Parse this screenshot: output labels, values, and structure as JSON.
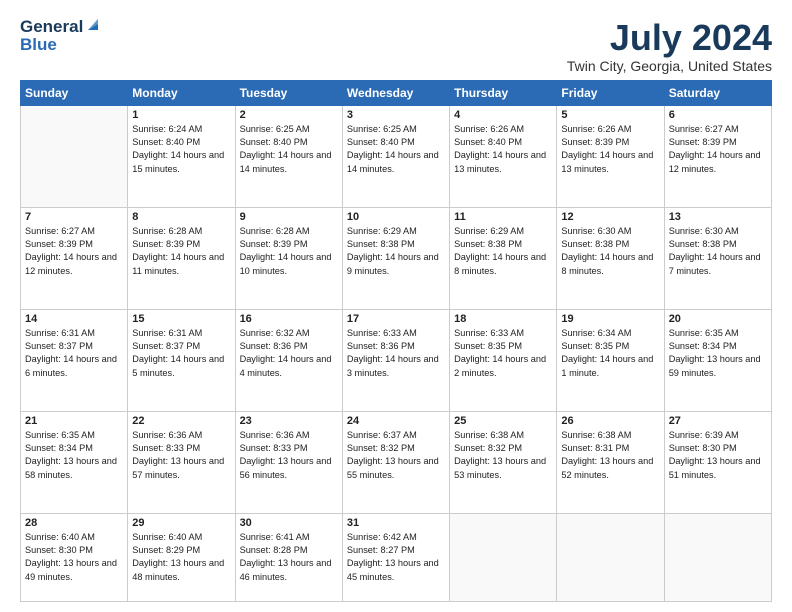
{
  "logo": {
    "general": "General",
    "blue": "Blue"
  },
  "header": {
    "title": "July 2024",
    "subtitle": "Twin City, Georgia, United States"
  },
  "weekdays": [
    "Sunday",
    "Monday",
    "Tuesday",
    "Wednesday",
    "Thursday",
    "Friday",
    "Saturday"
  ],
  "weeks": [
    [
      {
        "day": "",
        "sunrise": "",
        "sunset": "",
        "daylight": ""
      },
      {
        "day": "1",
        "sunrise": "Sunrise: 6:24 AM",
        "sunset": "Sunset: 8:40 PM",
        "daylight": "Daylight: 14 hours and 15 minutes."
      },
      {
        "day": "2",
        "sunrise": "Sunrise: 6:25 AM",
        "sunset": "Sunset: 8:40 PM",
        "daylight": "Daylight: 14 hours and 14 minutes."
      },
      {
        "day": "3",
        "sunrise": "Sunrise: 6:25 AM",
        "sunset": "Sunset: 8:40 PM",
        "daylight": "Daylight: 14 hours and 14 minutes."
      },
      {
        "day": "4",
        "sunrise": "Sunrise: 6:26 AM",
        "sunset": "Sunset: 8:40 PM",
        "daylight": "Daylight: 14 hours and 13 minutes."
      },
      {
        "day": "5",
        "sunrise": "Sunrise: 6:26 AM",
        "sunset": "Sunset: 8:39 PM",
        "daylight": "Daylight: 14 hours and 13 minutes."
      },
      {
        "day": "6",
        "sunrise": "Sunrise: 6:27 AM",
        "sunset": "Sunset: 8:39 PM",
        "daylight": "Daylight: 14 hours and 12 minutes."
      }
    ],
    [
      {
        "day": "7",
        "sunrise": "Sunrise: 6:27 AM",
        "sunset": "Sunset: 8:39 PM",
        "daylight": "Daylight: 14 hours and 12 minutes."
      },
      {
        "day": "8",
        "sunrise": "Sunrise: 6:28 AM",
        "sunset": "Sunset: 8:39 PM",
        "daylight": "Daylight: 14 hours and 11 minutes."
      },
      {
        "day": "9",
        "sunrise": "Sunrise: 6:28 AM",
        "sunset": "Sunset: 8:39 PM",
        "daylight": "Daylight: 14 hours and 10 minutes."
      },
      {
        "day": "10",
        "sunrise": "Sunrise: 6:29 AM",
        "sunset": "Sunset: 8:38 PM",
        "daylight": "Daylight: 14 hours and 9 minutes."
      },
      {
        "day": "11",
        "sunrise": "Sunrise: 6:29 AM",
        "sunset": "Sunset: 8:38 PM",
        "daylight": "Daylight: 14 hours and 8 minutes."
      },
      {
        "day": "12",
        "sunrise": "Sunrise: 6:30 AM",
        "sunset": "Sunset: 8:38 PM",
        "daylight": "Daylight: 14 hours and 8 minutes."
      },
      {
        "day": "13",
        "sunrise": "Sunrise: 6:30 AM",
        "sunset": "Sunset: 8:38 PM",
        "daylight": "Daylight: 14 hours and 7 minutes."
      }
    ],
    [
      {
        "day": "14",
        "sunrise": "Sunrise: 6:31 AM",
        "sunset": "Sunset: 8:37 PM",
        "daylight": "Daylight: 14 hours and 6 minutes."
      },
      {
        "day": "15",
        "sunrise": "Sunrise: 6:31 AM",
        "sunset": "Sunset: 8:37 PM",
        "daylight": "Daylight: 14 hours and 5 minutes."
      },
      {
        "day": "16",
        "sunrise": "Sunrise: 6:32 AM",
        "sunset": "Sunset: 8:36 PM",
        "daylight": "Daylight: 14 hours and 4 minutes."
      },
      {
        "day": "17",
        "sunrise": "Sunrise: 6:33 AM",
        "sunset": "Sunset: 8:36 PM",
        "daylight": "Daylight: 14 hours and 3 minutes."
      },
      {
        "day": "18",
        "sunrise": "Sunrise: 6:33 AM",
        "sunset": "Sunset: 8:35 PM",
        "daylight": "Daylight: 14 hours and 2 minutes."
      },
      {
        "day": "19",
        "sunrise": "Sunrise: 6:34 AM",
        "sunset": "Sunset: 8:35 PM",
        "daylight": "Daylight: 14 hours and 1 minute."
      },
      {
        "day": "20",
        "sunrise": "Sunrise: 6:35 AM",
        "sunset": "Sunset: 8:34 PM",
        "daylight": "Daylight: 13 hours and 59 minutes."
      }
    ],
    [
      {
        "day": "21",
        "sunrise": "Sunrise: 6:35 AM",
        "sunset": "Sunset: 8:34 PM",
        "daylight": "Daylight: 13 hours and 58 minutes."
      },
      {
        "day": "22",
        "sunrise": "Sunrise: 6:36 AM",
        "sunset": "Sunset: 8:33 PM",
        "daylight": "Daylight: 13 hours and 57 minutes."
      },
      {
        "day": "23",
        "sunrise": "Sunrise: 6:36 AM",
        "sunset": "Sunset: 8:33 PM",
        "daylight": "Daylight: 13 hours and 56 minutes."
      },
      {
        "day": "24",
        "sunrise": "Sunrise: 6:37 AM",
        "sunset": "Sunset: 8:32 PM",
        "daylight": "Daylight: 13 hours and 55 minutes."
      },
      {
        "day": "25",
        "sunrise": "Sunrise: 6:38 AM",
        "sunset": "Sunset: 8:32 PM",
        "daylight": "Daylight: 13 hours and 53 minutes."
      },
      {
        "day": "26",
        "sunrise": "Sunrise: 6:38 AM",
        "sunset": "Sunset: 8:31 PM",
        "daylight": "Daylight: 13 hours and 52 minutes."
      },
      {
        "day": "27",
        "sunrise": "Sunrise: 6:39 AM",
        "sunset": "Sunset: 8:30 PM",
        "daylight": "Daylight: 13 hours and 51 minutes."
      }
    ],
    [
      {
        "day": "28",
        "sunrise": "Sunrise: 6:40 AM",
        "sunset": "Sunset: 8:30 PM",
        "daylight": "Daylight: 13 hours and 49 minutes."
      },
      {
        "day": "29",
        "sunrise": "Sunrise: 6:40 AM",
        "sunset": "Sunset: 8:29 PM",
        "daylight": "Daylight: 13 hours and 48 minutes."
      },
      {
        "day": "30",
        "sunrise": "Sunrise: 6:41 AM",
        "sunset": "Sunset: 8:28 PM",
        "daylight": "Daylight: 13 hours and 46 minutes."
      },
      {
        "day": "31",
        "sunrise": "Sunrise: 6:42 AM",
        "sunset": "Sunset: 8:27 PM",
        "daylight": "Daylight: 13 hours and 45 minutes."
      },
      {
        "day": "",
        "sunrise": "",
        "sunset": "",
        "daylight": ""
      },
      {
        "day": "",
        "sunrise": "",
        "sunset": "",
        "daylight": ""
      },
      {
        "day": "",
        "sunrise": "",
        "sunset": "",
        "daylight": ""
      }
    ]
  ]
}
